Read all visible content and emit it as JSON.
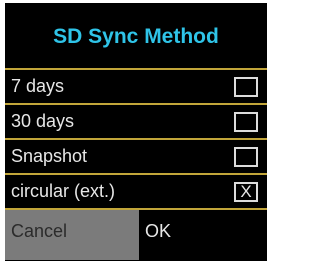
{
  "dialog": {
    "title": "SD Sync Method",
    "options": [
      {
        "label": "7 days",
        "checked": false,
        "mark": ""
      },
      {
        "label": "30 days",
        "checked": false,
        "mark": ""
      },
      {
        "label": "Snapshot",
        "checked": false,
        "mark": ""
      },
      {
        "label": "circular (ext.)",
        "checked": true,
        "mark": "X"
      }
    ],
    "buttons": {
      "cancel": "Cancel",
      "ok": "OK"
    }
  },
  "colors": {
    "title": "#2fc4e8",
    "separator": "#c2a63a",
    "background": "#000000",
    "cancel_bg": "#7b7b7b"
  }
}
